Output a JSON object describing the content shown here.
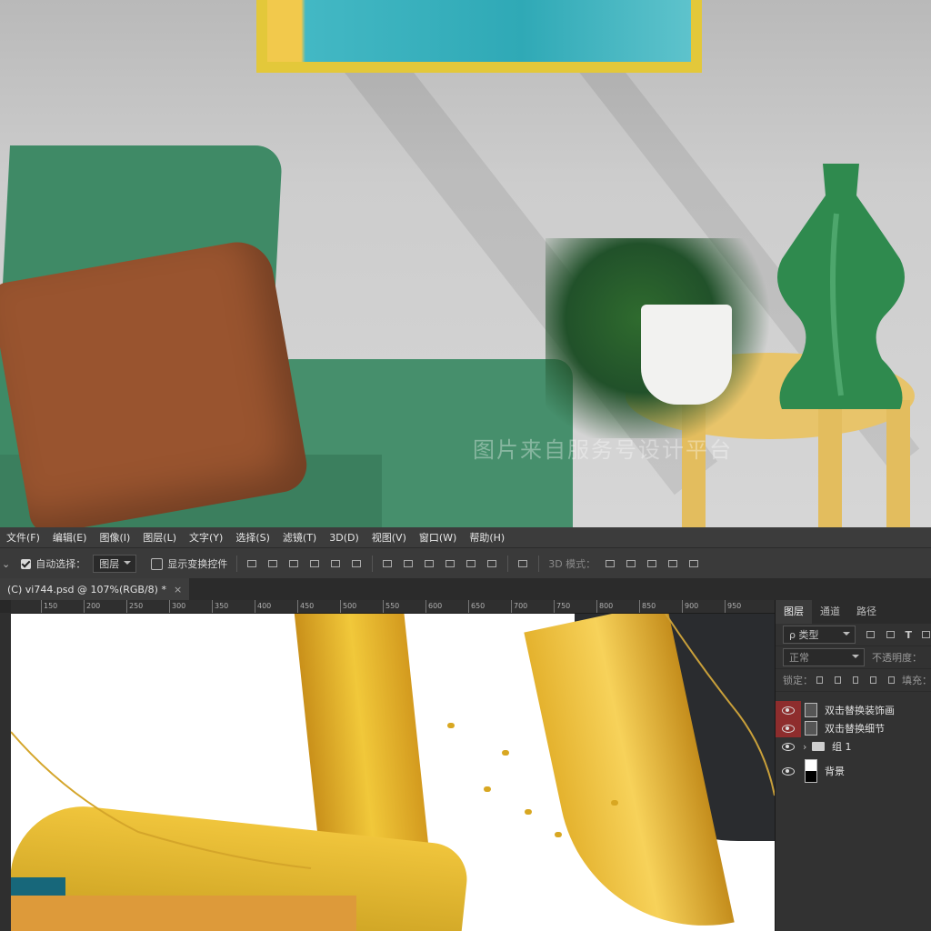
{
  "menubar": {
    "items": [
      "文件(F)",
      "编辑(E)",
      "图像(I)",
      "图层(L)",
      "文字(Y)",
      "选择(S)",
      "滤镜(T)",
      "3D(D)",
      "视图(V)",
      "窗口(W)",
      "帮助(H)"
    ]
  },
  "options_bar": {
    "auto_select_label": "自动选择：",
    "auto_select_value": "图层",
    "show_transform_label": "显示变换控件",
    "mode_3d_label": "3D 模式："
  },
  "document_tab": {
    "title": "(C) vi744.psd @ 107%(RGB/8) *",
    "close": "×"
  },
  "ruler": {
    "ticks": [
      "150",
      "200",
      "250",
      "300",
      "350",
      "400",
      "450",
      "500",
      "550",
      "600",
      "650",
      "700",
      "750",
      "800",
      "850",
      "900",
      "950"
    ]
  },
  "layers_panel": {
    "tabs": [
      "图层",
      "通道",
      "路径"
    ],
    "filter_label": "ρ 类型",
    "blend_mode": "正常",
    "opacity_label": "不透明度：",
    "lock_label": "锁定：",
    "fill_label": "填充：",
    "layers": [
      {
        "name": "双击替换装饰画",
        "highlighted": true,
        "type": "smart"
      },
      {
        "name": "双击替换细节",
        "highlighted": true,
        "type": "smart"
      },
      {
        "name": "组 1",
        "highlighted": false,
        "type": "group"
      },
      {
        "name": "背景",
        "highlighted": false,
        "type": "background"
      }
    ]
  },
  "watermark": "图片来自服务号设计平台"
}
